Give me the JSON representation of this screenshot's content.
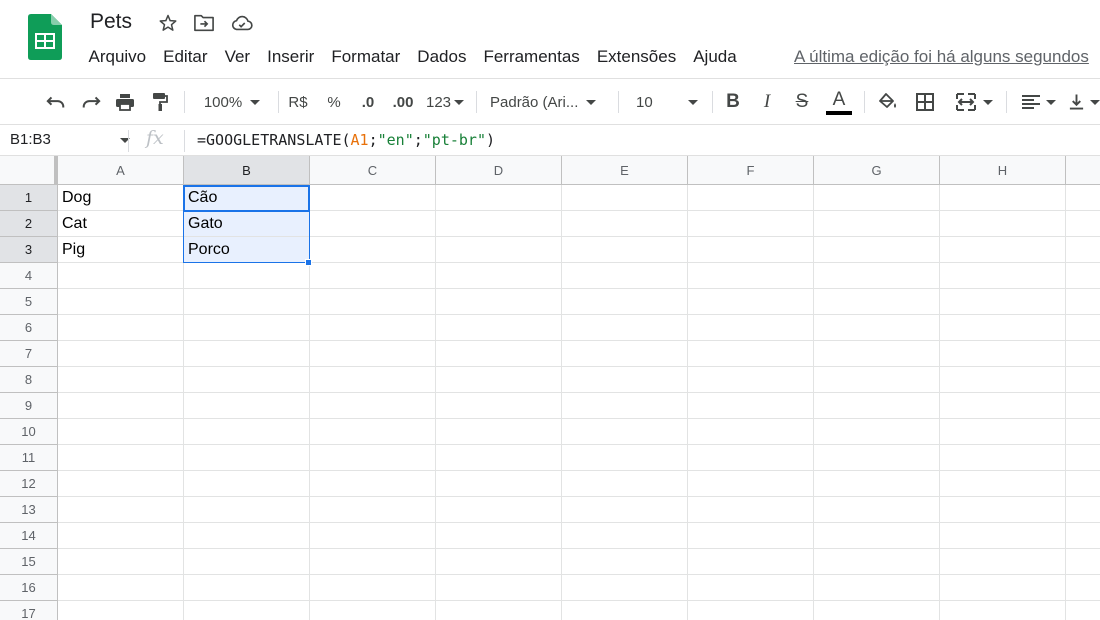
{
  "app": {
    "doc_title": "Pets",
    "last_edit": "A última edição foi há alguns segundos",
    "brand_color": "#0f9d58"
  },
  "menu": [
    "Arquivo",
    "Editar",
    "Ver",
    "Inserir",
    "Formatar",
    "Dados",
    "Ferramentas",
    "Extensões",
    "Ajuda"
  ],
  "toolbar": {
    "zoom": "100%",
    "currency": "R$",
    "percent": "%",
    "decrease_decimal": ".0",
    "increase_decimal": ".00",
    "more_formats": "123",
    "font": "Padrão (Ari...",
    "font_size": "10",
    "bold": "B",
    "italic": "I",
    "strikethrough": "S",
    "text_color": "A"
  },
  "formula_bar": {
    "name_box": "B1:B3",
    "fx": "fx",
    "formula_prefix": "=GOOGLETRANSLATE(",
    "formula_ref": "A1",
    "formula_sep1": ";",
    "formula_arg2": "\"en\"",
    "formula_sep2": ";",
    "formula_arg3": "\"pt-br\"",
    "formula_suffix": ")"
  },
  "grid": {
    "columns": [
      "A",
      "B",
      "C",
      "D",
      "E",
      "F",
      "G",
      "H"
    ],
    "rows": [
      "1",
      "2",
      "3",
      "4",
      "5",
      "6",
      "7",
      "8",
      "9",
      "10",
      "11",
      "12",
      "13",
      "14",
      "15",
      "16",
      "17"
    ],
    "cells": {
      "A1": "Dog",
      "A2": "Cat",
      "A3": "Pig",
      "B1": "Cão",
      "B2": "Gato",
      "B3": "Porco"
    },
    "selected_range": "B1:B3",
    "selection_color": "#1a73e8"
  }
}
